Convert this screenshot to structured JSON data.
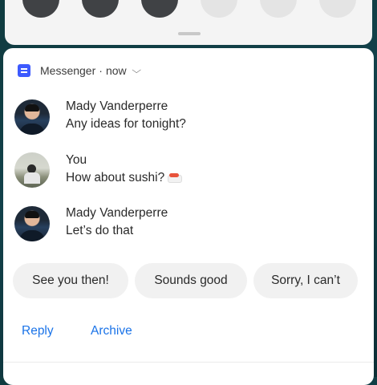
{
  "quick_settings": {
    "tiles": [
      {
        "icon": "quick-settings-tile-icon",
        "state": "on"
      },
      {
        "icon": "quick-settings-tile-icon",
        "state": "on"
      },
      {
        "icon": "quick-settings-tile-icon",
        "state": "on"
      },
      {
        "icon": "quick-settings-tile-icon",
        "state": "off"
      },
      {
        "icon": "quick-settings-tile-icon",
        "state": "off"
      },
      {
        "icon": "quick-settings-tile-icon",
        "state": "off"
      }
    ]
  },
  "notification": {
    "app_name": "Messenger",
    "separator": "·",
    "time": "now",
    "expand_icon": "chevron-down-icon",
    "accent_color": "#1a73e8",
    "messages": [
      {
        "sender": "Mady Vanderperre",
        "text": "Any ideas for tonight?"
      },
      {
        "sender": "You",
        "text": "How about sushi?"
      },
      {
        "sender": "Mady Vanderperre",
        "text": "Let’s do that"
      }
    ],
    "smart_replies": [
      "See you then!",
      "Sounds good",
      "Sorry, I can’t"
    ],
    "actions": [
      "Reply",
      "Archive"
    ]
  }
}
